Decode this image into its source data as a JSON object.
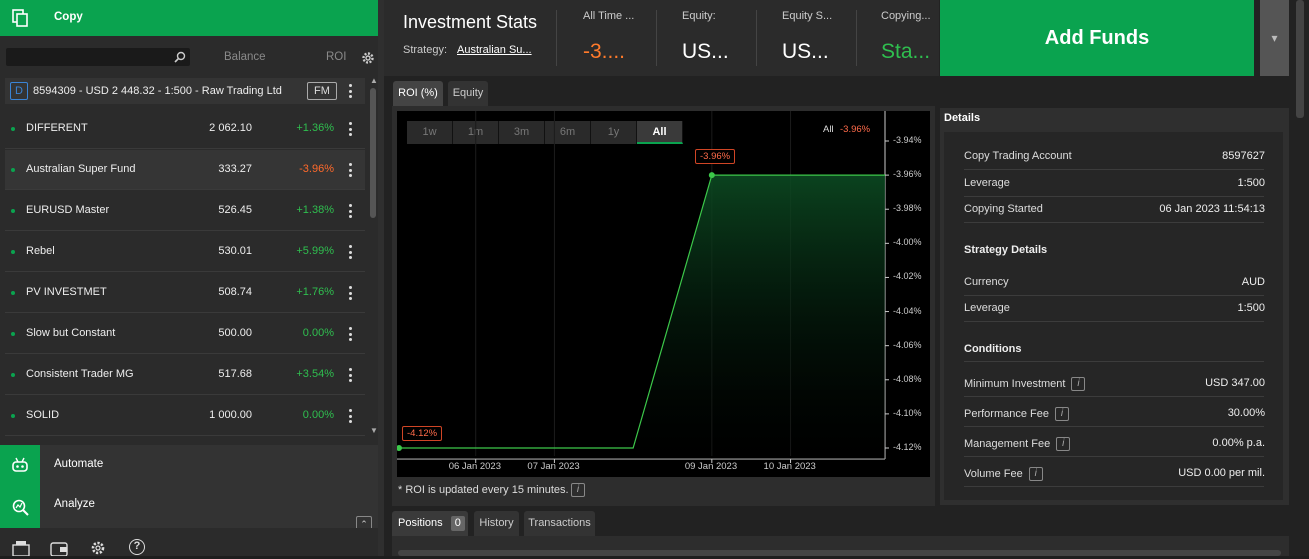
{
  "sidebar": {
    "title": "Copy",
    "columns": {
      "balance": "Balance",
      "roi": "ROI"
    },
    "account": {
      "type_badge": "D",
      "label": "8594309 - USD 2 448.32 - 1:500 - Raw Trading Ltd",
      "badge": "FM"
    },
    "strategies": [
      {
        "name": "DIFFERENT",
        "balance": "2 062.10",
        "roi": "+1.36%",
        "roi_color": "#2fbf4f"
      },
      {
        "name": "Australian Super Fund",
        "balance": "333.27",
        "roi": "-3.96%",
        "roi_color": "#ff6a2b"
      },
      {
        "name": "EURUSD Master",
        "balance": "526.45",
        "roi": "+1.38%",
        "roi_color": "#2fbf4f"
      },
      {
        "name": "Rebel",
        "balance": "530.01",
        "roi": "+5.99%",
        "roi_color": "#2fbf4f"
      },
      {
        "name": "PV INVESTMET",
        "balance": "508.74",
        "roi": "+1.76%",
        "roi_color": "#2fbf4f"
      },
      {
        "name": "Slow but Constant",
        "balance": "500.00",
        "roi": "0.00%",
        "roi_color": "#2fbf4f"
      },
      {
        "name": "Consistent Trader MG",
        "balance": "517.68",
        "roi": "+3.54%",
        "roi_color": "#2fbf4f"
      },
      {
        "name": "SOLID",
        "balance": "1 000.00",
        "roi": "0.00%",
        "roi_color": "#2fbf4f"
      }
    ],
    "nav": [
      {
        "label": "Automate",
        "icon": "robot-icon"
      },
      {
        "label": "Analyze",
        "icon": "analyze-icon"
      }
    ]
  },
  "stats": {
    "title": "Investment Stats",
    "strategy_label": "Strategy:",
    "strategy_value": "Australian Su...",
    "all_time_label": "All Time ...",
    "all_time_value": "-3....",
    "equity_label": "Equity:",
    "equity_value": "US...",
    "equity_s_label": "Equity S...",
    "equity_s_value": "US...",
    "copying_label": "Copying...",
    "copying_value": "Sta...",
    "add_funds": "Add Funds",
    "dropdown_icon": "▾"
  },
  "chart_tabs": {
    "roi": "ROI (%)",
    "equity": "Equity"
  },
  "ranges": [
    "1w",
    "1m",
    "3m",
    "6m",
    "1y",
    "All"
  ],
  "legend": {
    "label": "All",
    "value": "-3.96%"
  },
  "chart_data": {
    "type": "area",
    "x": [
      "05 Jan 2023",
      "08 Jan 2023",
      "09 Jan 2023",
      "12 Jan 2023"
    ],
    "values": [
      -4.12,
      -4.12,
      -3.96,
      -3.96
    ],
    "x_ticks": [
      "06 Jan 2023",
      "07 Jan 2023",
      "09 Jan 2023",
      "10 Jan 2023"
    ],
    "y_ticks": [
      "-3.94%",
      "-3.96%",
      "-3.98%",
      "-4.00%",
      "-4.02%",
      "-4.04%",
      "-4.06%",
      "-4.08%",
      "-4.10%",
      "-4.12%"
    ],
    "ylim": [
      -4.12,
      -3.94
    ],
    "start_label": "-4.12%",
    "end_label": "-3.96%",
    "line_color": "#3cc84a"
  },
  "roi_note": "* ROI is updated every 15 minutes.",
  "bottom_tabs": {
    "positions": "Positions",
    "positions_count": "0",
    "history": "History",
    "transactions": "Transactions"
  },
  "details": {
    "title": "Details",
    "rows1": [
      {
        "k": "Copy Trading Account",
        "v": "8597627"
      },
      {
        "k": "Leverage",
        "v": "1:500"
      },
      {
        "k": "Copying Started",
        "v": "06 Jan 2023 11:54:13"
      }
    ],
    "strategy_details": "Strategy Details",
    "rows2": [
      {
        "k": "Currency",
        "v": "AUD"
      },
      {
        "k": "Leverage",
        "v": "1:500"
      }
    ],
    "conditions": "Conditions",
    "rows3": [
      {
        "k": "Minimum Investment",
        "v": "USD 347.00"
      },
      {
        "k": "Performance Fee",
        "v": "30.00%"
      },
      {
        "k": "Management Fee",
        "v": "0.00% p.a."
      },
      {
        "k": "Volume Fee",
        "v": "USD 0.00 per mil."
      }
    ]
  }
}
